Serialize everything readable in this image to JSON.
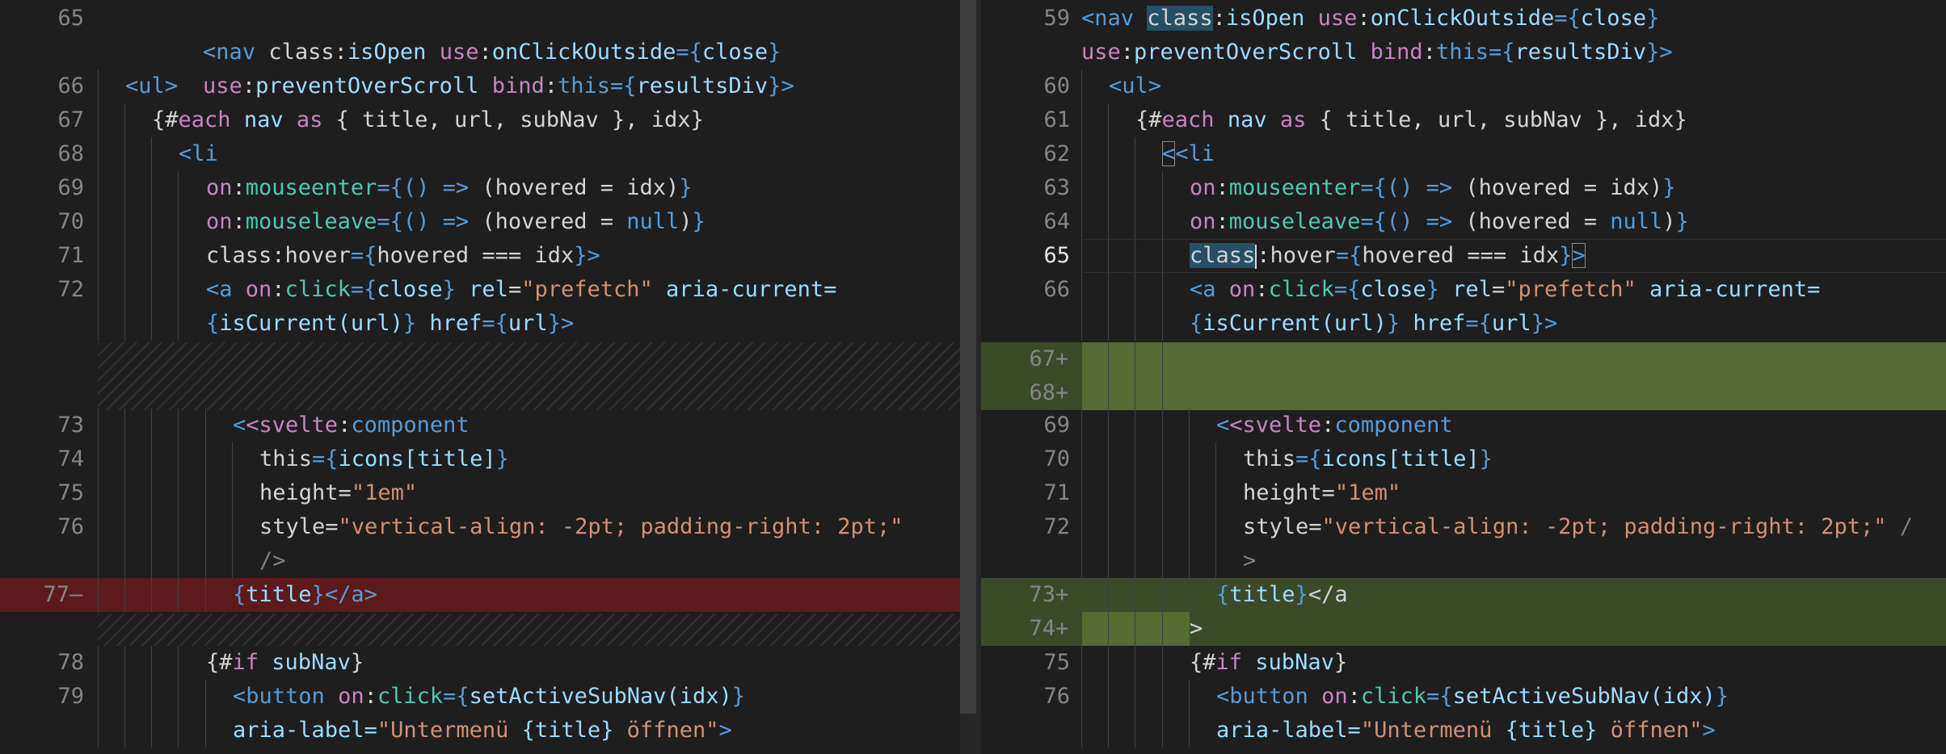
{
  "left": {
    "lines": {
      "n65": "65",
      "n66": "66",
      "n67": "67",
      "n68": "68",
      "n69": "69",
      "n70": "70",
      "n71": "71",
      "n72": "72",
      "n73": "73",
      "n74": "74",
      "n75": "75",
      "n76": "76",
      "n77": "77",
      "n78": "78",
      "n79": "79"
    },
    "deleted_marker": "–"
  },
  "right": {
    "lines": {
      "n59": "59",
      "n60": "60",
      "n61": "61",
      "n62": "62",
      "n63": "63",
      "n64": "64",
      "n65": "65",
      "n66": "66",
      "n67": "67",
      "n68": "68",
      "n69": "69",
      "n70": "70",
      "n71": "71",
      "n72": "72",
      "n73": "73",
      "n74": "74",
      "n75": "75",
      "n76": "76"
    },
    "inserted_marker": "+"
  },
  "code": {
    "nav_tag": "<nav",
    "class_kw": "class",
    "colon": ":",
    "isOpen": "isOpen",
    "use_kw": "use",
    "onClickOutside": "onClickOutside",
    "eq_brace": "={",
    "close": "close",
    "close_brace": "}",
    "preventOverScroll": "preventOverScroll",
    "bind_kw": "bind",
    "this_kw": "this",
    "resultsDiv": "resultsDiv",
    "close_tag_brace": "}>",
    "ul_tag": "<ul>",
    "each_open": "{#",
    "each_kw": "each",
    "nav_name": "nav",
    "as_kw": "as",
    "destructure": "{ title, url, subNav }, idx}",
    "li_tag": "<li",
    "on_kw": "on",
    "mouseenter": "mouseenter",
    "mouseleave": "mouseleave",
    "arrow_open": "() =>",
    "hovered_idx": "(hovered = idx)",
    "hovered_null_pre": "(hovered = ",
    "null_kw": "null",
    "paren_close": ")",
    "hover_kw": "hover",
    "hovered_cmp": "hovered === idx",
    "a_tag": "<a",
    "click_kw": "click",
    "rel_attr": "rel",
    "prefetch_str": "\"prefetch\"",
    "aria_current": "aria-current=",
    "isCurrent_call": "isCurrent(url)",
    "href_attr": "href",
    "url_name": "url",
    "svelte_open": "<svelte",
    "component_kw": "component",
    "this_attr": "this",
    "icons_title": "icons[title]",
    "height_attr": "height",
    "em_str": "\"1em\"",
    "style_attr": "style",
    "style_str": "\"vertical-align: -2pt; padding-right: 2pt;\"",
    "self_close": "/>",
    "self_close_slash": "/",
    "gt": ">",
    "title_name": "title",
    "a_close_full": "</a>",
    "a_close_partial": "</a",
    "if_open": "{#",
    "if_kw": "if",
    "subNav_name": "subNav",
    "button_tag": "<button",
    "setActiveSubNav": "setActiveSubNav(idx)",
    "aria_label": "aria-label=",
    "aria_label_str_a": "\"Untermenü ",
    "aria_label_title": "{title}",
    "aria_label_str_b": " öffnen\"",
    "space": " ",
    "eq": "=",
    "open_brace": "{",
    "lt": "<"
  },
  "colors": {
    "background": "#1e1e1e",
    "deleted": "#5c1a1c",
    "inserted": "#3b4a27",
    "inserted_strong": "#556b31",
    "keyword": "#c586c0",
    "tag": "#569cd6",
    "attribute": "#9cdcfe",
    "string": "#ce9178"
  }
}
